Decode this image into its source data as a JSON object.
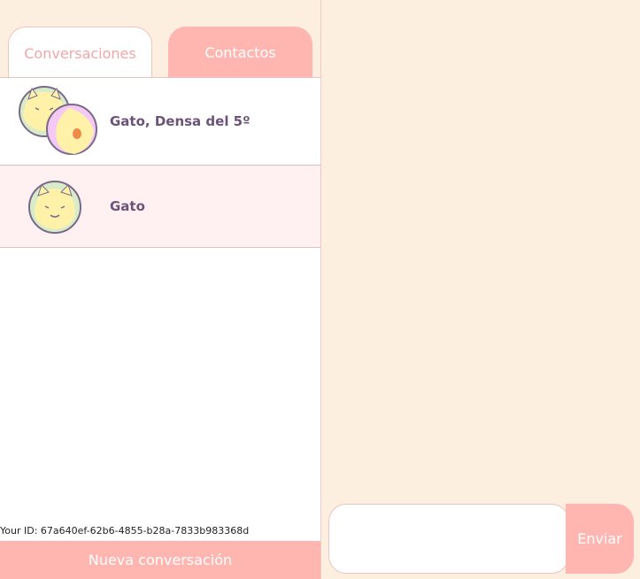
{
  "tabs": {
    "conversations_label": "Conversaciones",
    "contacts_label": "Contactos"
  },
  "conversations": [
    {
      "name": "Gato, Densa del 5º",
      "avatar": "group-cat-chick-avatar"
    },
    {
      "name": "Gato",
      "avatar": "cat-avatar",
      "selected": true
    }
  ],
  "footer": {
    "id_text": "Your ID: 67a640ef-62b6-4855-b28a-7833b983368d",
    "new_conversation_label": "Nueva conversación"
  },
  "composer": {
    "input_value": "",
    "send_label": "Enviar"
  },
  "colors": {
    "accent": "#ffb6b1",
    "background": "#fdefe0",
    "name_text": "#6b5478",
    "selected_row": "#fff1f1"
  }
}
